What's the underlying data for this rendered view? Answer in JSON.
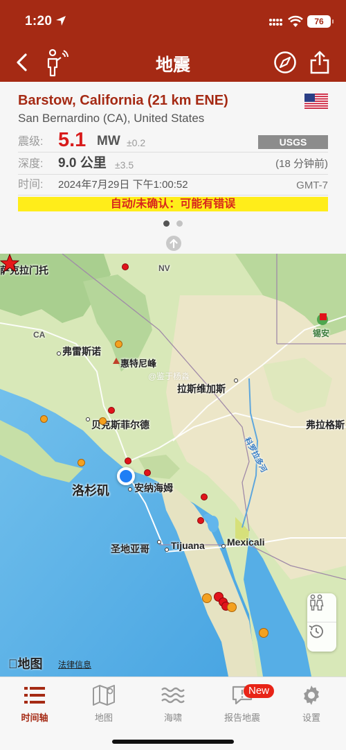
{
  "status_bar": {
    "time": "1:20",
    "battery": "76"
  },
  "nav": {
    "title": "地震"
  },
  "event": {
    "place": "Barstow, California (21 km ENE)",
    "region": "San Bernardino (CA), United States",
    "mag_label": "震级:",
    "mag_value": "5.1",
    "mag_unit": "MW",
    "mag_err": "±0.2",
    "source": "USGS",
    "depth_label": "深度:",
    "depth_value": "9.0 公里",
    "depth_err": "±3.5",
    "time_ago": "(18 分钟前)",
    "time_label": "时间:",
    "datetime": "2024年7月29日 下午1:00:52",
    "timezone": "GMT-7",
    "warning": "自动/未确认：可能有错误"
  },
  "map": {
    "labels": {
      "sacramento": "萨克拉门托",
      "nv": "NV",
      "ca": "CA",
      "fresno": "弗雷斯诺",
      "whitney": "惠特尼峰",
      "lasvegas": "拉斯维加斯",
      "bakersfield": "贝克斯菲尔德",
      "flagstaff": "弗拉格斯",
      "la": "洛杉矶",
      "anaheim": "安纳海姆",
      "sandiego": "圣地亚哥",
      "tijuana": "Tijuana",
      "mexicali": "Mexicali",
      "colorado": "科罗拉多河",
      "stgeorge": "锡安",
      "watermark": "@鉴于杨淼"
    },
    "apple_maps": "地图",
    "legal": "法律信息"
  },
  "tabs": [
    {
      "label": "时间轴",
      "active": true
    },
    {
      "label": "地图",
      "active": false
    },
    {
      "label": "海啸",
      "active": false
    },
    {
      "label": "报告地震",
      "active": false,
      "badge": "New"
    },
    {
      "label": "设置",
      "active": false
    }
  ],
  "colors": {
    "brand": "#a52a14",
    "magnitude": "#d81c1c",
    "warning_bg": "#ffed1a"
  }
}
